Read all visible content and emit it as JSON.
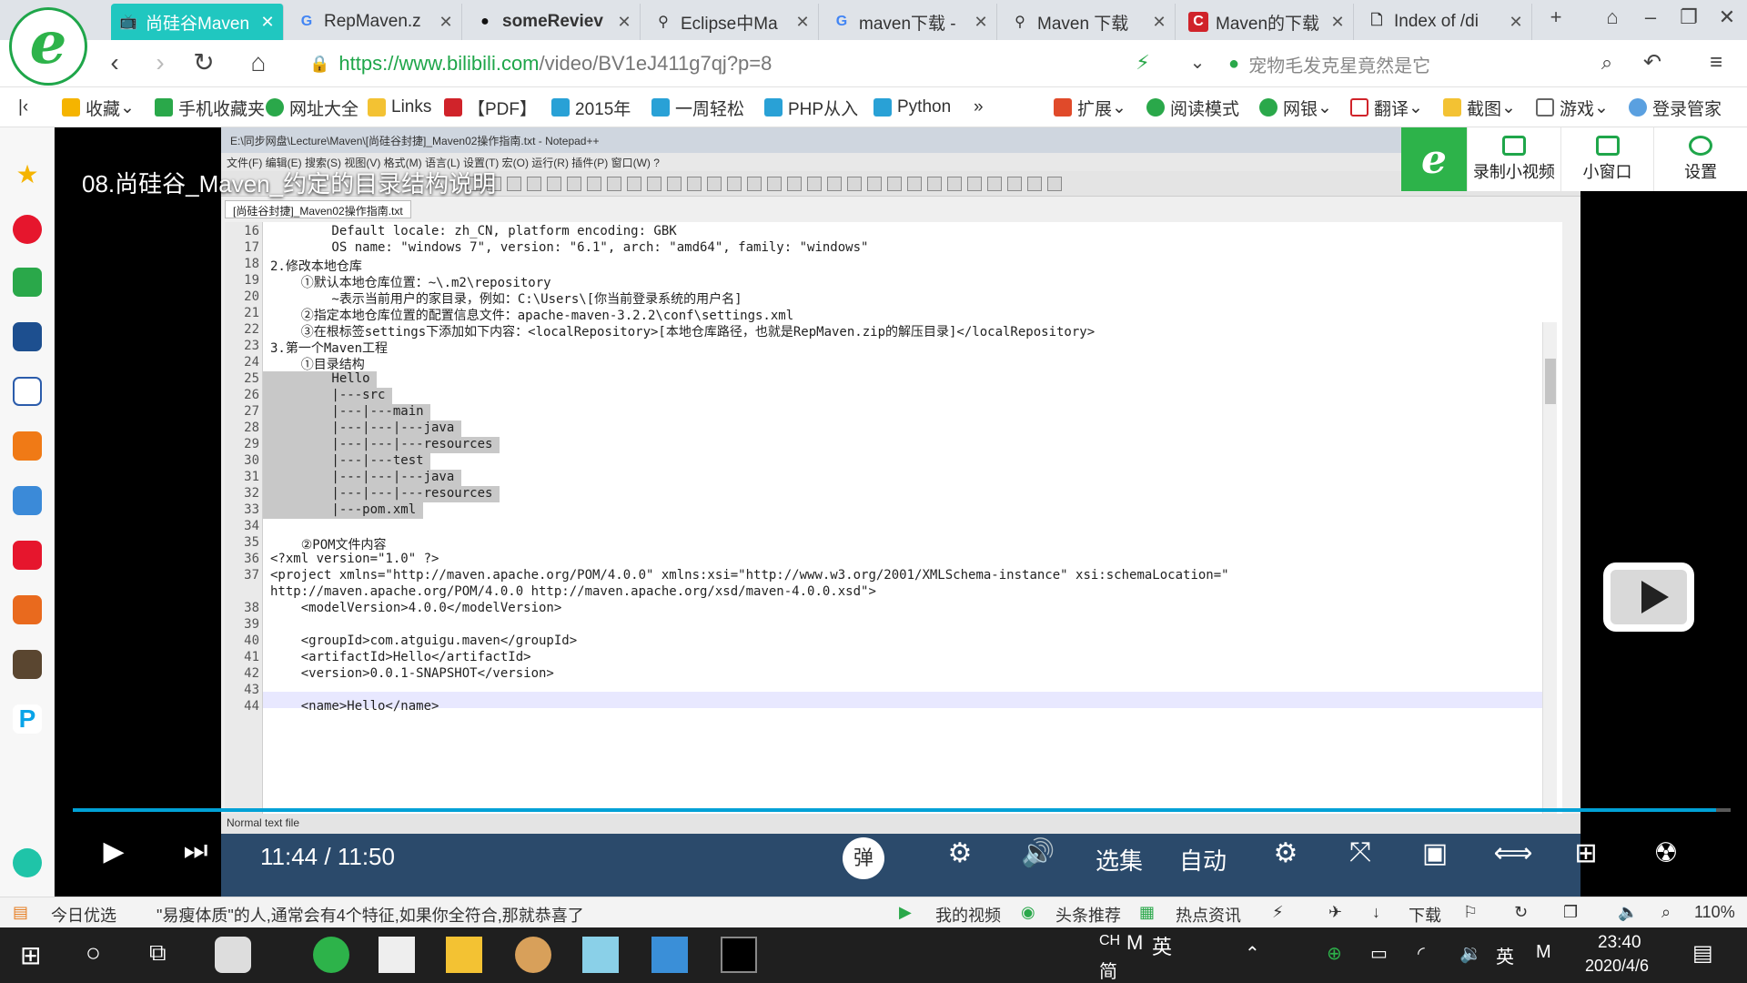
{
  "tabs": [
    {
      "label": "尚硅谷Maven",
      "icon": "bilibili-icon",
      "active": true
    },
    {
      "label": "RepMaven.z",
      "icon": "google-icon",
      "active": false
    },
    {
      "label": "someReviev",
      "icon": "github-icon",
      "active": false
    },
    {
      "label": "Eclipse中Ma",
      "icon": "csdn-icon",
      "active": false
    },
    {
      "label": "maven下载 -",
      "icon": "google-icon",
      "active": false
    },
    {
      "label": "Maven 下载",
      "icon": "csdn-icon",
      "active": false
    },
    {
      "label": "Maven的下载",
      "icon": "c-icon",
      "active": false
    },
    {
      "label": "Index of /di",
      "icon": "page-icon",
      "active": false
    }
  ],
  "address": {
    "scheme": "https://",
    "host": "www.bilibili.com",
    "path": "/video/BV1eJ411g7qj?p=8"
  },
  "search": {
    "placeholder": "宠物毛发克星竟然是它"
  },
  "bookmarks": {
    "left": [
      "收藏",
      "手机收藏夹",
      "网址大全",
      "Links",
      "【PDF】",
      "2015年",
      "一周轻松",
      "PHP从入",
      "Python"
    ],
    "right": [
      "扩展",
      "阅读模式",
      "网银",
      "翻译",
      "截图",
      "游戏",
      "登录管家"
    ]
  },
  "video": {
    "title": "08.尚硅谷_Maven_约定的目录结构说明",
    "time_current": "11:44",
    "time_separator": "/",
    "time_total": "11:50",
    "progress": 0.991,
    "danmaku_label": "弹",
    "episodes_label": "选集",
    "auto_label": "自动"
  },
  "overlay": {
    "record_label": "录制小视频",
    "miniwindow_label": "小窗口",
    "settings_label": "设置"
  },
  "notepad": {
    "title": "E:\\同步网盘\\Lecture\\Maven\\[尚硅谷封捷]_Maven02操作指南.txt - Notepad++",
    "menu": "文件(F)  编辑(E)  搜索(S)  视图(V)  格式(M)  语言(L)  设置(T)  宏(O)  运行(R)  插件(P)  窗口(W)  ?",
    "tab": "[尚硅谷封捷]_Maven02操作指南.txt",
    "status": "Normal text file",
    "lines": [
      {
        "n": "16",
        "t": "        Default locale: zh_CN, platform encoding: GBK"
      },
      {
        "n": "17",
        "t": "        OS name: \"windows 7\", version: \"6.1\", arch: \"amd64\", family: \"windows\""
      },
      {
        "n": "18",
        "t": "2.修改本地仓库"
      },
      {
        "n": "19",
        "t": "    ①默认本地仓库位置：~\\.m2\\repository"
      },
      {
        "n": "20",
        "t": "        ~表示当前用户的家目录，例如：C:\\Users\\[你当前登录系统的用户名]"
      },
      {
        "n": "21",
        "t": "    ②指定本地仓库位置的配置信息文件：apache-maven-3.2.2\\conf\\settings.xml"
      },
      {
        "n": "22",
        "t": "    ③在根标签settings下添加如下内容：<localRepository>[本地仓库路径，也就是RepMaven.zip的解压目录]</localRepository>"
      },
      {
        "n": "23",
        "t": "3.第一个Maven工程"
      },
      {
        "n": "24",
        "t": "    ①目录结构"
      },
      {
        "n": "25",
        "t": "        Hello"
      },
      {
        "n": "26",
        "t": "        |---src"
      },
      {
        "n": "27",
        "t": "        |---|---main"
      },
      {
        "n": "28",
        "t": "        |---|---|---java"
      },
      {
        "n": "29",
        "t": "        |---|---|---resources"
      },
      {
        "n": "30",
        "t": "        |---|---test"
      },
      {
        "n": "31",
        "t": "        |---|---|---java"
      },
      {
        "n": "32",
        "t": "        |---|---|---resources"
      },
      {
        "n": "33",
        "t": "        |---pom.xml"
      },
      {
        "n": "34",
        "t": ""
      },
      {
        "n": "35",
        "t": "    ②POM文件内容"
      },
      {
        "n": "36",
        "t": "<?xml version=\"1.0\" ?>"
      },
      {
        "n": "37",
        "t": "<project xmlns=\"http://maven.apache.org/POM/4.0.0\" xmlns:xsi=\"http://www.w3.org/2001/XMLSchema-instance\" xsi:schemaLocation=\""
      },
      {
        "n": "",
        "t": "http://maven.apache.org/POM/4.0.0 http://maven.apache.org/xsd/maven-4.0.0.xsd\">"
      },
      {
        "n": "38",
        "t": "    <modelVersion>4.0.0</modelVersion>"
      },
      {
        "n": "39",
        "t": ""
      },
      {
        "n": "40",
        "t": "    <groupId>com.atguigu.maven</groupId>"
      },
      {
        "n": "41",
        "t": "    <artifactId>Hello</artifactId>"
      },
      {
        "n": "42",
        "t": "    <version>0.0.1-SNAPSHOT</version>"
      },
      {
        "n": "43",
        "t": ""
      },
      {
        "n": "44",
        "t": "    <name>Hello</name>"
      }
    ]
  },
  "statusbar": {
    "today": "今日优选",
    "news": "\"易瘦体质\"的人,通常会有4个特征,如果你全符合,那就恭喜了",
    "myvideo": "我的视频",
    "headline": "头条推荐",
    "hotnews": "热点资讯",
    "download": "下载",
    "zoom": "110%"
  },
  "taskbar": {
    "ime_ch": "CH",
    "ime_en": "英",
    "ime_jian": "简",
    "tray_lang": "英",
    "time": "23:40",
    "date": "2020/4/6"
  },
  "colors": {
    "active_tab": "#20c7c0",
    "url_host": "#1fa64a",
    "progress": "#00a1d6",
    "brand_green": "#2db34a"
  }
}
